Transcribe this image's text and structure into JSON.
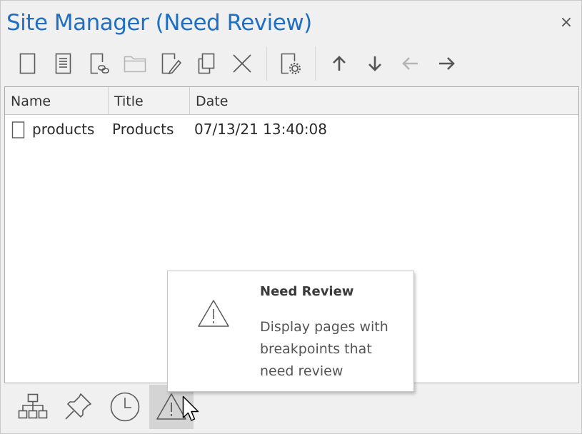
{
  "window": {
    "title": "Site Manager (Need Review)",
    "close_glyph": "×"
  },
  "toolbar": {
    "buttons": [
      {
        "icon": "new-page-icon"
      },
      {
        "icon": "new-document-icon"
      },
      {
        "icon": "new-link-icon"
      },
      {
        "icon": "new-folder-icon",
        "disabled": true
      },
      {
        "icon": "rename-icon"
      },
      {
        "icon": "duplicate-icon"
      },
      {
        "icon": "delete-icon"
      },
      {
        "icon": "page-settings-icon"
      },
      {
        "icon": "move-up-icon"
      },
      {
        "icon": "move-down-icon"
      },
      {
        "icon": "move-left-icon",
        "disabled": true
      },
      {
        "icon": "move-right-icon"
      }
    ]
  },
  "list": {
    "columns": [
      "Name",
      "Title",
      "Date"
    ],
    "rows": [
      {
        "name": "products",
        "title": "Products",
        "date": "07/13/21 13:40:08"
      }
    ]
  },
  "tooltip": {
    "title": "Need Review",
    "description": "Display pages with breakpoints that need review"
  },
  "bottombar": {
    "views": [
      {
        "icon": "site-map-icon",
        "active": false
      },
      {
        "icon": "pin-icon",
        "active": false
      },
      {
        "icon": "clock-icon",
        "active": false
      },
      {
        "icon": "warning-icon",
        "active": true
      }
    ]
  },
  "colors": {
    "title": "#1f6fc4",
    "icon": "#5a5a5a",
    "icon_disabled": "#b5b5b5",
    "active_tab": "#d4d4d4"
  }
}
